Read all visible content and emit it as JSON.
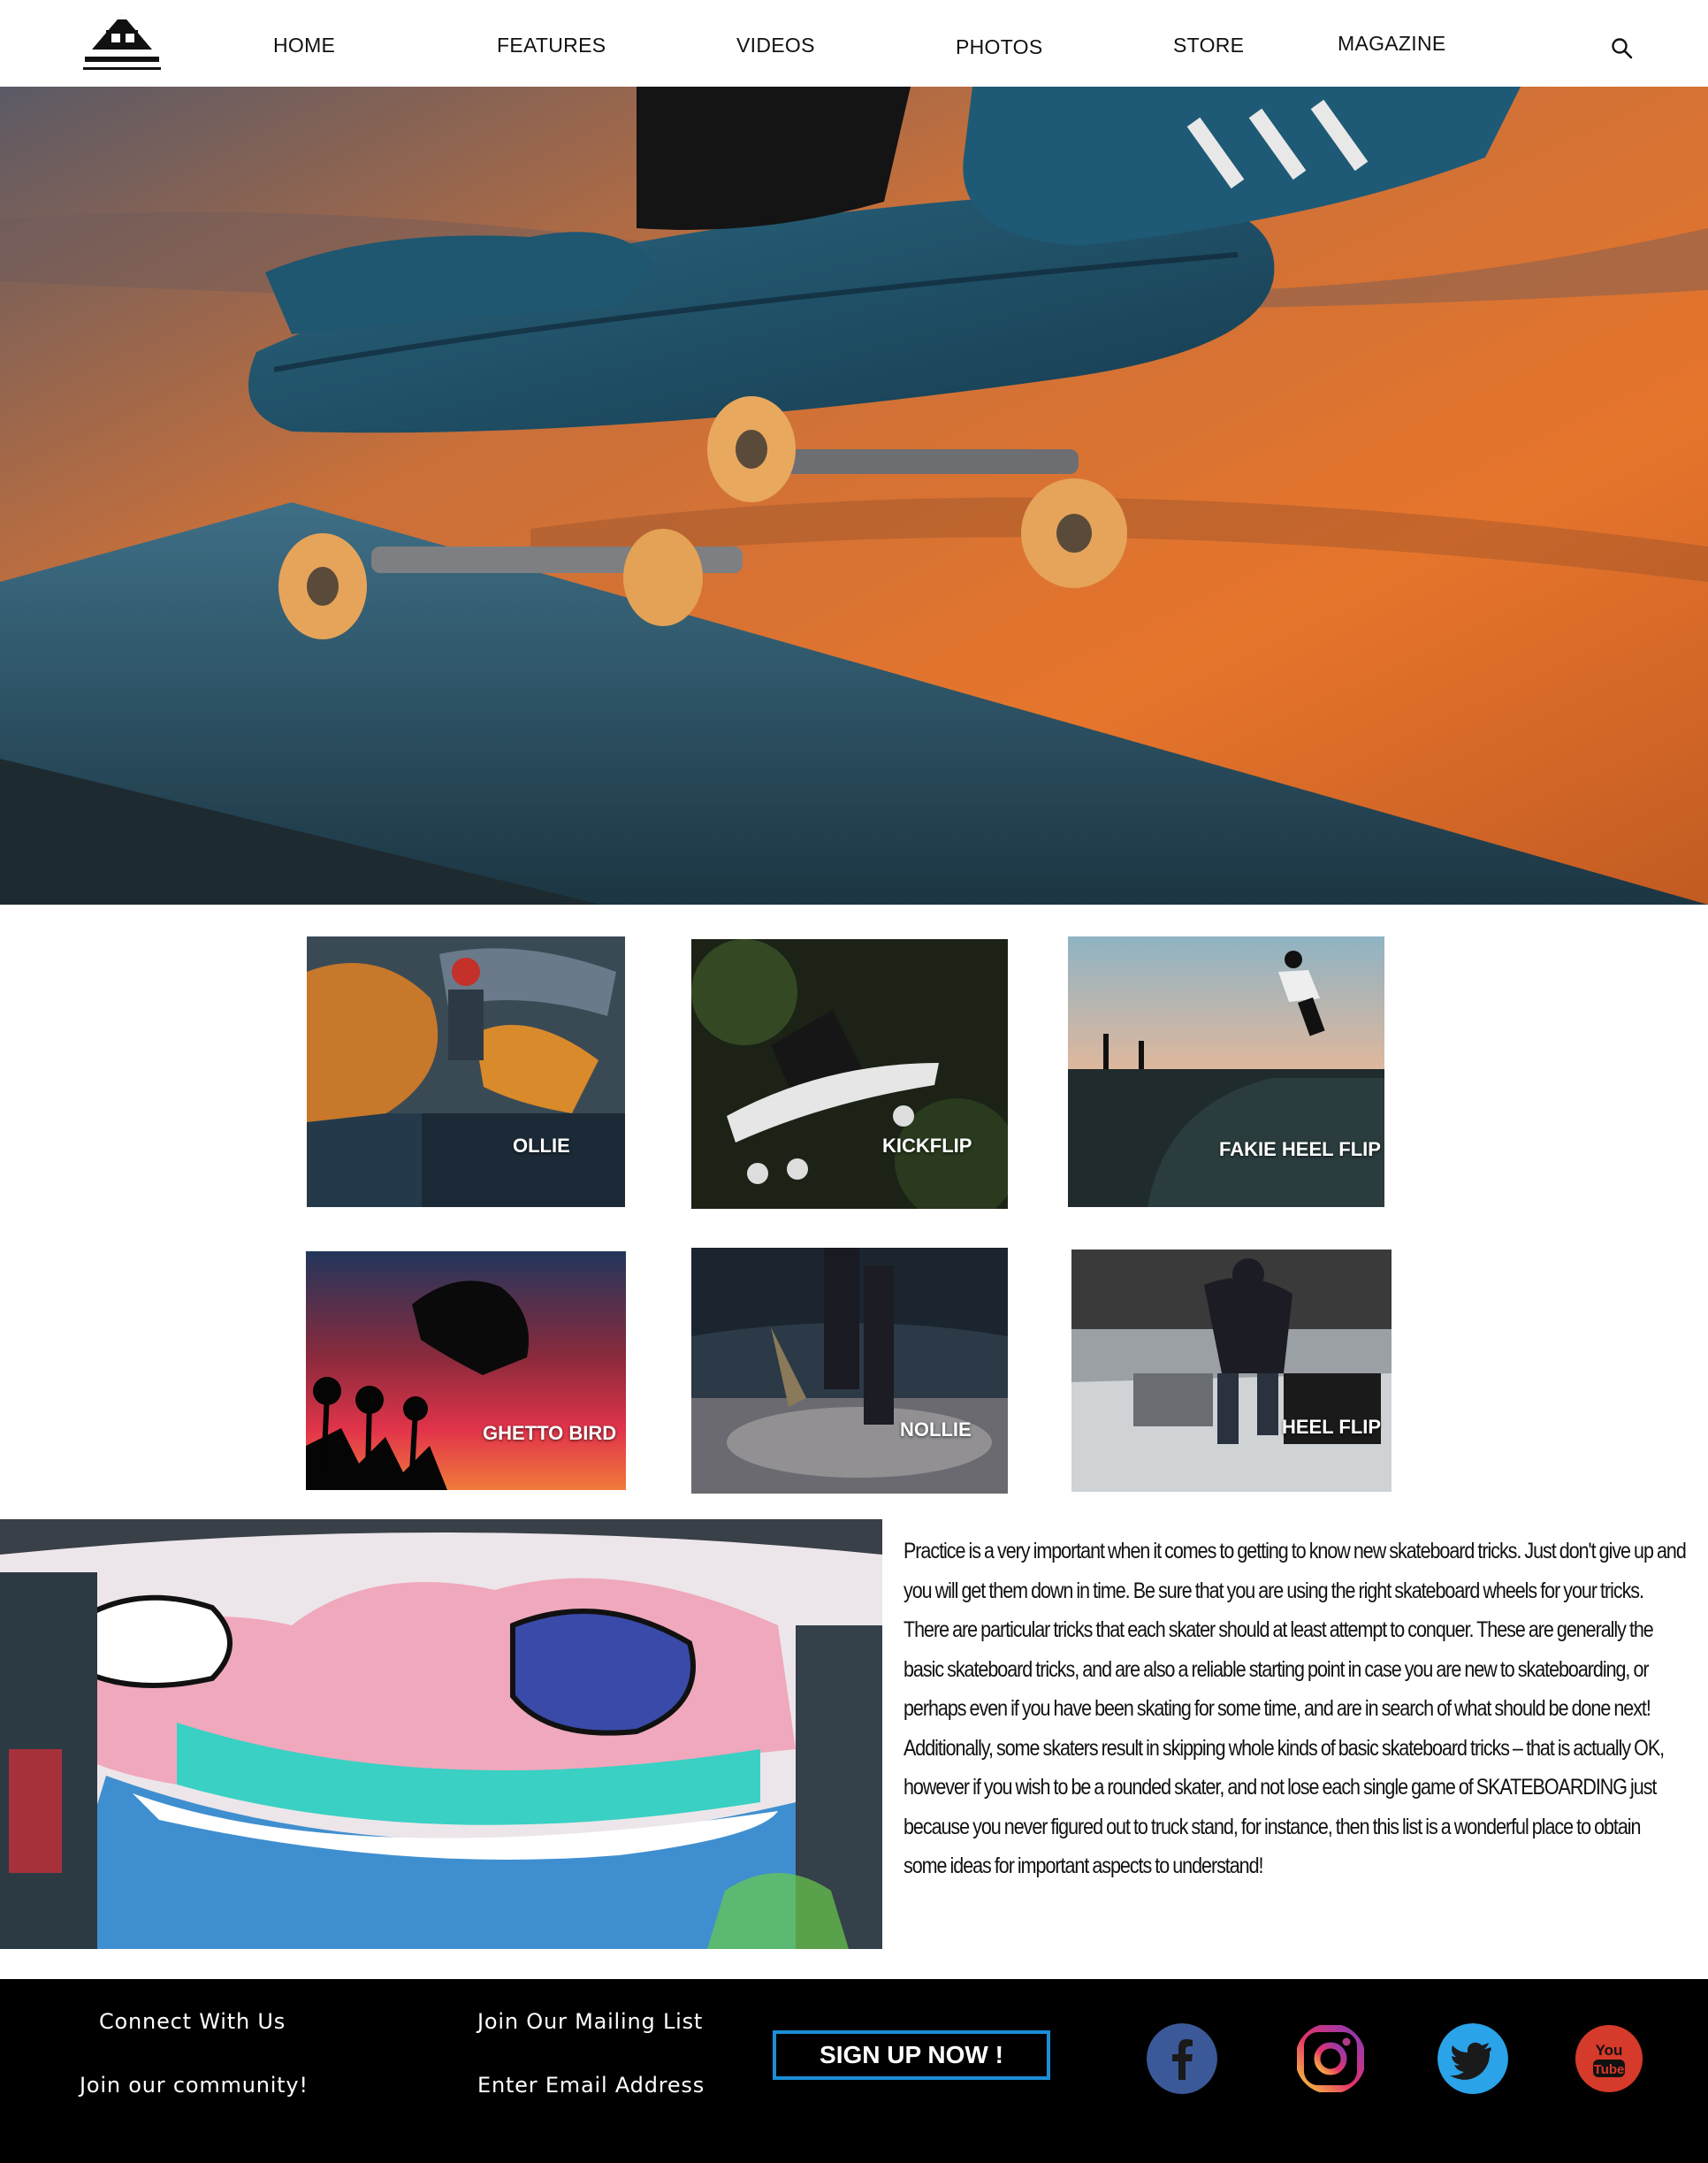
{
  "nav": {
    "items": [
      {
        "label": "HOME"
      },
      {
        "label": "FEATURES"
      },
      {
        "label": "VIDEOS"
      },
      {
        "label": "PHOTOS"
      },
      {
        "label": "STORE"
      },
      {
        "label": "MAGAZINE"
      }
    ],
    "icons": {
      "logo": "house-logo-icon",
      "search": "search-icon"
    }
  },
  "tiles": [
    {
      "label": "OLLIE"
    },
    {
      "label": "KICKFLIP"
    },
    {
      "label": "FAKIE HEEL FLIP"
    },
    {
      "label": "GHETTO BIRD"
    },
    {
      "label": "NOLLIE"
    },
    {
      "label": "HEEL FLIP"
    }
  ],
  "article": {
    "text": "Practice is a very important when it comes to getting to know new skateboard tricks. Just don't give up and you will get them down in time. Be sure that you are using the right skateboard wheels for your tricks. There are particular tricks that each skater should at least attempt to conquer. These are generally the basic skateboard tricks, and are also a reliable starting point in case you are new to skateboarding, or perhaps even if you have been skating for some time, and are in search of what should be done next! Additionally, some skaters result in skipping whole kinds of basic skateboard tricks – that is actually OK, however if you wish to be a rounded skater, and not lose each single game of SKATEBOARDING just because you never figured out to truck stand, for instance, then this list is a wonderful place to obtain some ideas for important aspects to understand!"
  },
  "footer": {
    "connect": "Connect With Us",
    "community": "Join our community!",
    "mailing": "Join Our Mailing List",
    "email_placeholder": "Enter Email Address",
    "signup": "SIGN UP NOW !",
    "social": [
      "facebook-icon",
      "instagram-icon",
      "twitter-icon",
      "youtube-icon"
    ]
  },
  "colors": {
    "accent_blue": "#1b8ed8",
    "footer_bg": "#000000",
    "facebook": "#3b5998",
    "twitter": "#2aa3e8",
    "youtube": "#d63a2a"
  }
}
